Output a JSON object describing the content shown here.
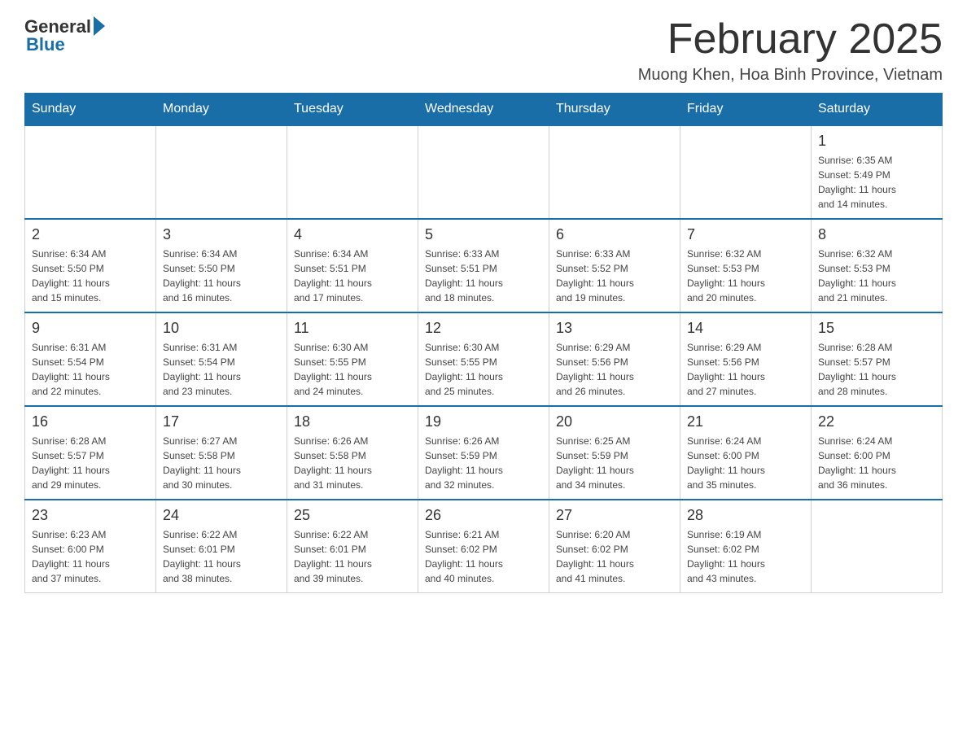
{
  "header": {
    "logo": {
      "general_text": "General",
      "blue_text": "Blue"
    },
    "title": "February 2025",
    "location": "Muong Khen, Hoa Binh Province, Vietnam"
  },
  "weekdays": [
    "Sunday",
    "Monday",
    "Tuesday",
    "Wednesday",
    "Thursday",
    "Friday",
    "Saturday"
  ],
  "weeks": [
    [
      {
        "day": "",
        "info": ""
      },
      {
        "day": "",
        "info": ""
      },
      {
        "day": "",
        "info": ""
      },
      {
        "day": "",
        "info": ""
      },
      {
        "day": "",
        "info": ""
      },
      {
        "day": "",
        "info": ""
      },
      {
        "day": "1",
        "info": "Sunrise: 6:35 AM\nSunset: 5:49 PM\nDaylight: 11 hours\nand 14 minutes."
      }
    ],
    [
      {
        "day": "2",
        "info": "Sunrise: 6:34 AM\nSunset: 5:50 PM\nDaylight: 11 hours\nand 15 minutes."
      },
      {
        "day": "3",
        "info": "Sunrise: 6:34 AM\nSunset: 5:50 PM\nDaylight: 11 hours\nand 16 minutes."
      },
      {
        "day": "4",
        "info": "Sunrise: 6:34 AM\nSunset: 5:51 PM\nDaylight: 11 hours\nand 17 minutes."
      },
      {
        "day": "5",
        "info": "Sunrise: 6:33 AM\nSunset: 5:51 PM\nDaylight: 11 hours\nand 18 minutes."
      },
      {
        "day": "6",
        "info": "Sunrise: 6:33 AM\nSunset: 5:52 PM\nDaylight: 11 hours\nand 19 minutes."
      },
      {
        "day": "7",
        "info": "Sunrise: 6:32 AM\nSunset: 5:53 PM\nDaylight: 11 hours\nand 20 minutes."
      },
      {
        "day": "8",
        "info": "Sunrise: 6:32 AM\nSunset: 5:53 PM\nDaylight: 11 hours\nand 21 minutes."
      }
    ],
    [
      {
        "day": "9",
        "info": "Sunrise: 6:31 AM\nSunset: 5:54 PM\nDaylight: 11 hours\nand 22 minutes."
      },
      {
        "day": "10",
        "info": "Sunrise: 6:31 AM\nSunset: 5:54 PM\nDaylight: 11 hours\nand 23 minutes."
      },
      {
        "day": "11",
        "info": "Sunrise: 6:30 AM\nSunset: 5:55 PM\nDaylight: 11 hours\nand 24 minutes."
      },
      {
        "day": "12",
        "info": "Sunrise: 6:30 AM\nSunset: 5:55 PM\nDaylight: 11 hours\nand 25 minutes."
      },
      {
        "day": "13",
        "info": "Sunrise: 6:29 AM\nSunset: 5:56 PM\nDaylight: 11 hours\nand 26 minutes."
      },
      {
        "day": "14",
        "info": "Sunrise: 6:29 AM\nSunset: 5:56 PM\nDaylight: 11 hours\nand 27 minutes."
      },
      {
        "day": "15",
        "info": "Sunrise: 6:28 AM\nSunset: 5:57 PM\nDaylight: 11 hours\nand 28 minutes."
      }
    ],
    [
      {
        "day": "16",
        "info": "Sunrise: 6:28 AM\nSunset: 5:57 PM\nDaylight: 11 hours\nand 29 minutes."
      },
      {
        "day": "17",
        "info": "Sunrise: 6:27 AM\nSunset: 5:58 PM\nDaylight: 11 hours\nand 30 minutes."
      },
      {
        "day": "18",
        "info": "Sunrise: 6:26 AM\nSunset: 5:58 PM\nDaylight: 11 hours\nand 31 minutes."
      },
      {
        "day": "19",
        "info": "Sunrise: 6:26 AM\nSunset: 5:59 PM\nDaylight: 11 hours\nand 32 minutes."
      },
      {
        "day": "20",
        "info": "Sunrise: 6:25 AM\nSunset: 5:59 PM\nDaylight: 11 hours\nand 34 minutes."
      },
      {
        "day": "21",
        "info": "Sunrise: 6:24 AM\nSunset: 6:00 PM\nDaylight: 11 hours\nand 35 minutes."
      },
      {
        "day": "22",
        "info": "Sunrise: 6:24 AM\nSunset: 6:00 PM\nDaylight: 11 hours\nand 36 minutes."
      }
    ],
    [
      {
        "day": "23",
        "info": "Sunrise: 6:23 AM\nSunset: 6:00 PM\nDaylight: 11 hours\nand 37 minutes."
      },
      {
        "day": "24",
        "info": "Sunrise: 6:22 AM\nSunset: 6:01 PM\nDaylight: 11 hours\nand 38 minutes."
      },
      {
        "day": "25",
        "info": "Sunrise: 6:22 AM\nSunset: 6:01 PM\nDaylight: 11 hours\nand 39 minutes."
      },
      {
        "day": "26",
        "info": "Sunrise: 6:21 AM\nSunset: 6:02 PM\nDaylight: 11 hours\nand 40 minutes."
      },
      {
        "day": "27",
        "info": "Sunrise: 6:20 AM\nSunset: 6:02 PM\nDaylight: 11 hours\nand 41 minutes."
      },
      {
        "day": "28",
        "info": "Sunrise: 6:19 AM\nSunset: 6:02 PM\nDaylight: 11 hours\nand 43 minutes."
      },
      {
        "day": "",
        "info": ""
      }
    ]
  ]
}
